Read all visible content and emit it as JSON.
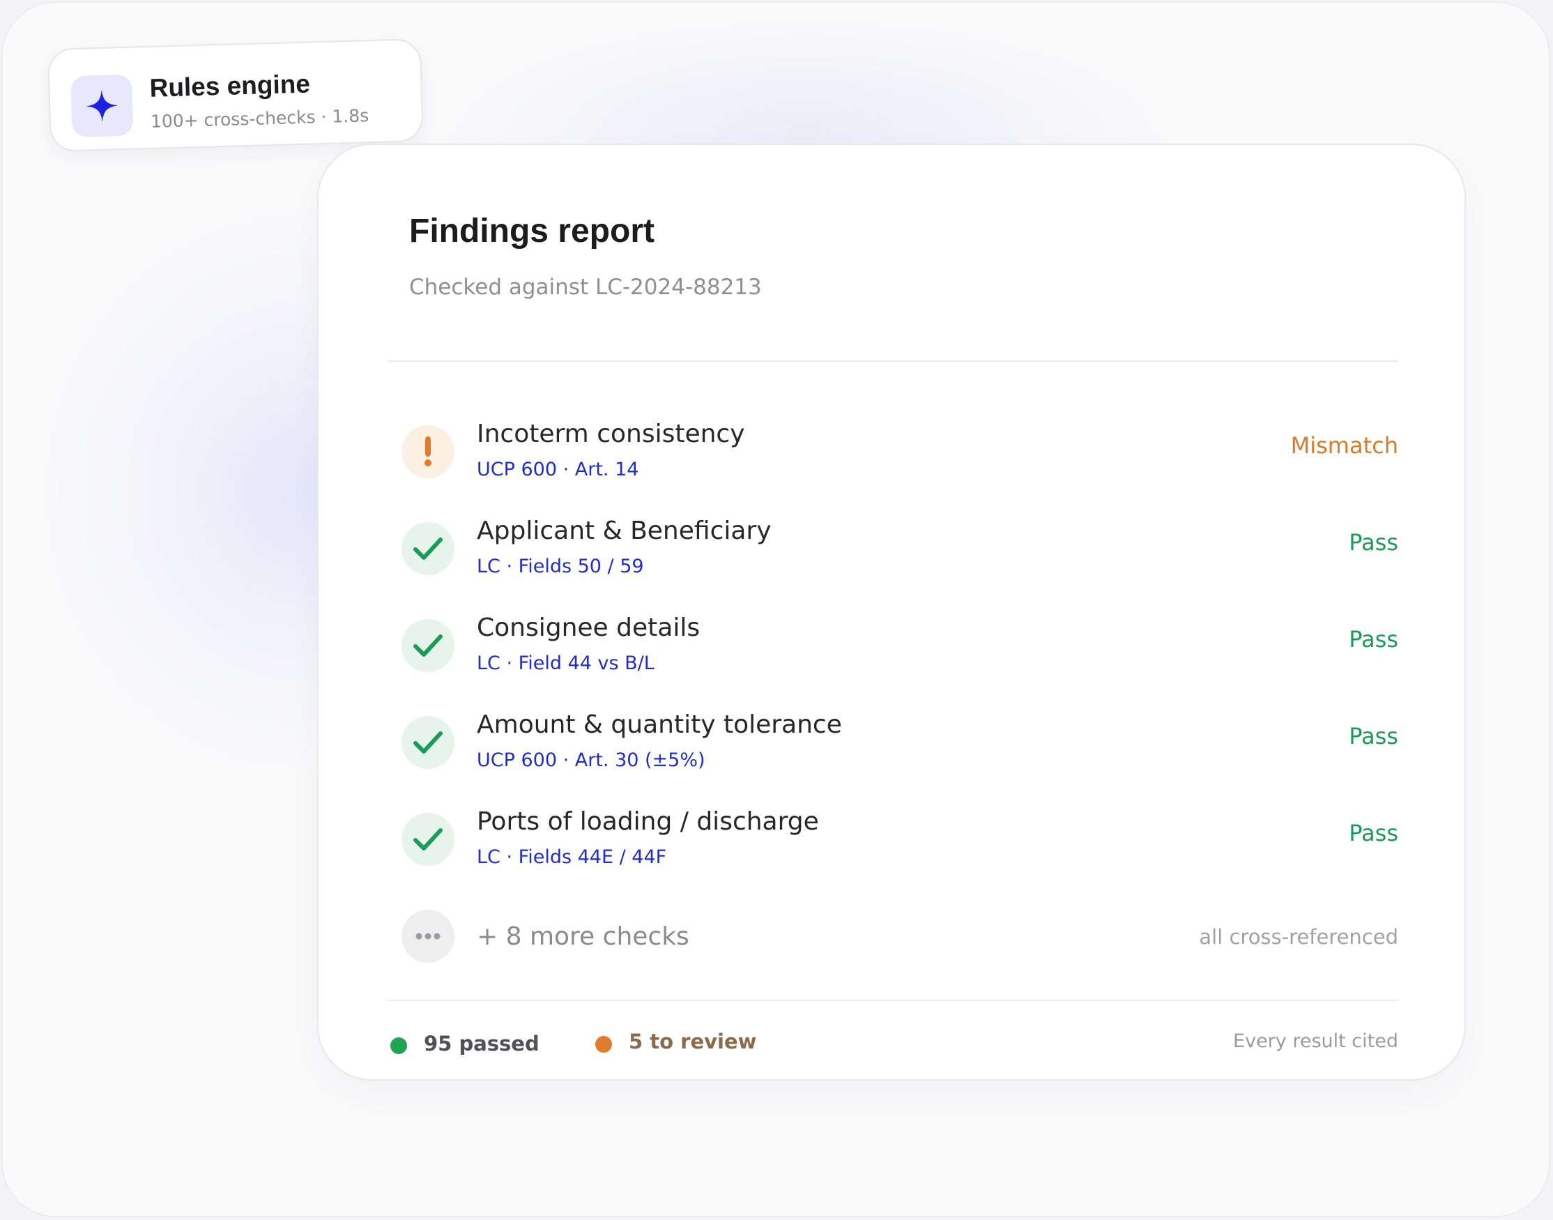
{
  "badge": {
    "icon": "sparkle-icon",
    "title": "Rules engine",
    "subtitle": "100+ cross-checks · 1.8s"
  },
  "report": {
    "title": "Findings report",
    "subtitle": "Checked against LC-2024-88213",
    "checks": [
      {
        "title": "Incoterm consistency",
        "reference": "UCP 600 · Art. 14",
        "status": "Mismatch",
        "state": "warn",
        "icon": "exclamation-icon"
      },
      {
        "title": "Applicant & Beneficiary",
        "reference": "LC · Fields 50 / 59",
        "status": "Pass",
        "state": "pass",
        "icon": "checkmark-icon"
      },
      {
        "title": "Consignee details",
        "reference": "LC · Field 44 vs B/L",
        "status": "Pass",
        "state": "pass",
        "icon": "checkmark-icon"
      },
      {
        "title": "Amount & quantity tolerance",
        "reference": "UCP 600 · Art. 30 (±5%)",
        "status": "Pass",
        "state": "pass",
        "icon": "checkmark-icon"
      },
      {
        "title": "Ports of loading / discharge",
        "reference": "LC · Fields 44E / 44F",
        "status": "Pass",
        "state": "pass",
        "icon": "checkmark-icon"
      }
    ],
    "more": {
      "icon": "ellipsis-icon",
      "label": "+ 8 more checks",
      "note": "all cross-referenced"
    },
    "footer": {
      "passed": "95 passed",
      "review": "5 to review",
      "note": "Every result cited"
    }
  },
  "colors": {
    "accent": "#1f2dcc",
    "pass": "#1c9a57",
    "warn": "#d87a2c"
  }
}
